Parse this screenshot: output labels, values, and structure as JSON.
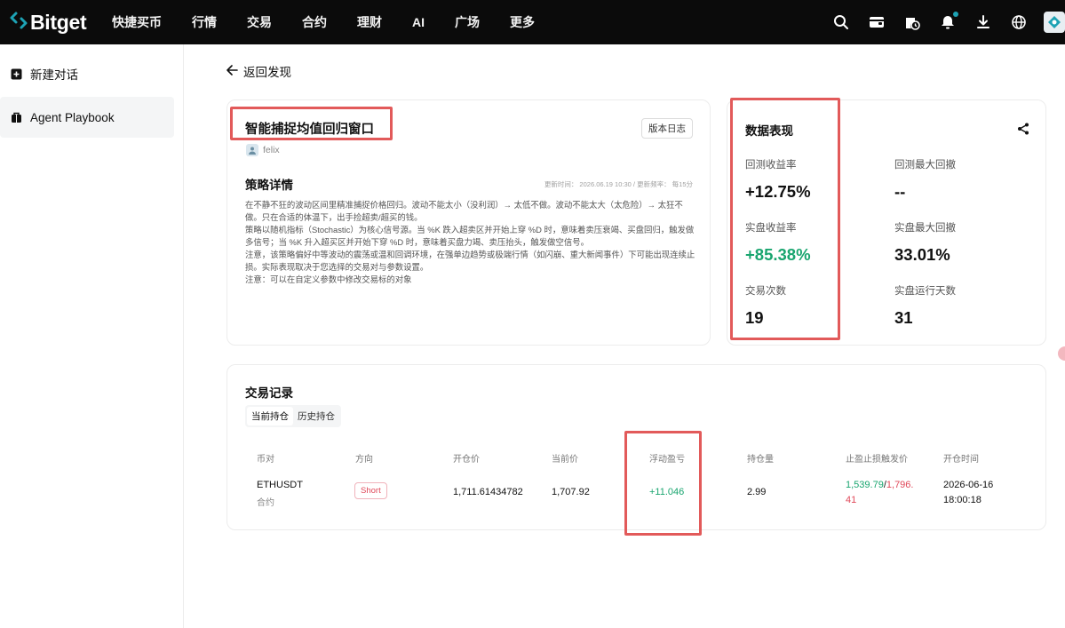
{
  "header": {
    "logo_text": "Bitget",
    "nav": [
      "快捷买币",
      "行情",
      "交易",
      "合约",
      "理财",
      "AI",
      "广场",
      "更多"
    ],
    "icons": [
      "search-icon",
      "wallet-icon",
      "clock-icon",
      "bell-icon",
      "download-icon",
      "globe-icon",
      "avatar"
    ]
  },
  "sidebar": {
    "items": [
      {
        "label": "新建对话",
        "icon": "new-chat-icon"
      },
      {
        "label": "Agent Playbook",
        "icon": "playbook-icon"
      }
    ]
  },
  "back": {
    "label": "返回发现"
  },
  "strategy": {
    "title": "智能捕捉均值回归窗口",
    "changelog_label": "版本日志",
    "author": "felix",
    "detail_title": "策略详情",
    "meta": "更新时间： 2026.06.19 10:30 / 更新频率： 每15分",
    "description": [
      "在不静不狂的波动区间里精准捕捉价格回归。波动不能太小（没利润）→ 太低不做。波动不能太大（太危险）→ 太狂不做。只在合适的体温下，出手捡超卖/超买的钱。",
      "策略以随机指标（Stochastic）为核心信号源。当 %K 跌入超卖区并开始上穿 %D 时，意味着卖压衰竭、买盘回归，触发做多信号；当 %K 升入超买区并开始下穿 %D 时，意味着买盘力竭、卖压抬头，触发做空信号。",
      "注意，该策略偏好中等波动的震荡或温和回调环境，在强单边趋势或极端行情（如闪崩、重大新闻事件）下可能出现连续止损。实际表现取决于您选择的交易对与参数设置。",
      "注意：可以在自定义参数中修改交易标的对象"
    ]
  },
  "performance": {
    "title": "数据表现",
    "metrics": [
      {
        "label": "回测收益率",
        "value": "+12.75%"
      },
      {
        "label": "回测最大回撤",
        "value": "--"
      },
      {
        "label": "实盘收益率",
        "value": "+85.38%"
      },
      {
        "label": "实盘最大回撤",
        "value": "33.01%"
      },
      {
        "label": "交易次数",
        "value": "19"
      },
      {
        "label": "实盘运行天数",
        "value": "31"
      }
    ]
  },
  "trades": {
    "title": "交易记录",
    "tabs": [
      "当前持仓",
      "历史持仓"
    ],
    "columns": [
      "币对",
      "方向",
      "开仓价",
      "当前价",
      "浮动盈亏",
      "持仓量",
      "止盈止损触发价",
      "开仓时间"
    ],
    "row": {
      "pair": "ETHUSDT",
      "pair_type": "合约",
      "direction": "Short",
      "open_price": "1,711.61434782",
      "current_price": "1,707.92",
      "pnl": "+11.046",
      "size": "2.99",
      "tp": "1,539.79",
      "sep": "/",
      "sl_line1": "1,796.",
      "sl_line2": "41",
      "open_date": "2026-06-16",
      "open_time": "18:00:18"
    }
  },
  "colors": {
    "accent": "#1da2b4",
    "green": "#19a56f",
    "red": "#e0495a",
    "highlight_box": "#e25a5a"
  }
}
